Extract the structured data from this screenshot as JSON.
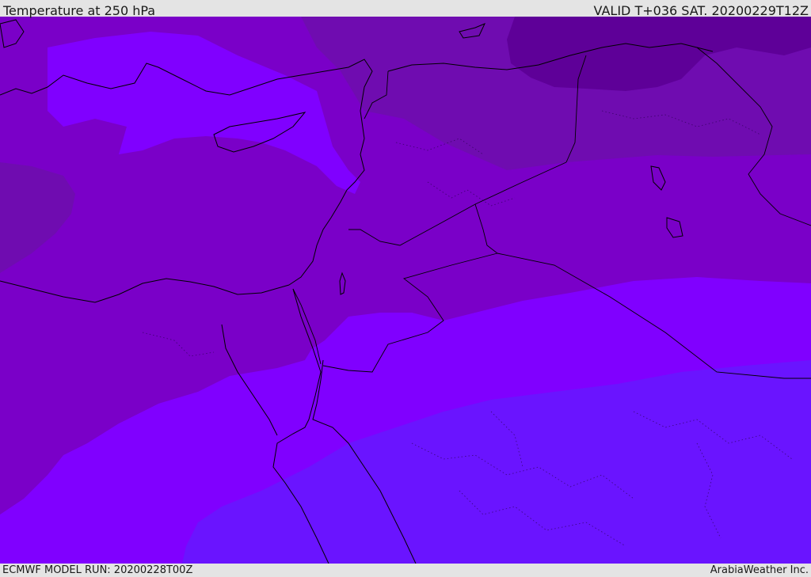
{
  "header": {
    "title": "Temperature at 250 hPa",
    "valid": "VALID T+036 SAT. 20200229T12Z"
  },
  "footer": {
    "model_run": "ECMWF MODEL RUN: 20200228T00Z",
    "credit": "ArabiaWeather Inc."
  },
  "map": {
    "variable": "Temperature",
    "level": "250 hPa",
    "region": "Eastern Mediterranean and Middle East",
    "colors": {
      "coldest_band": "#5e0098",
      "cold_band": "#6f0cb0",
      "cool_band": "#7a00c8",
      "mid_band": "#8000e6",
      "warm_band": "#8000ff",
      "warmest_band": "#6a14ff",
      "coastline": "#000000",
      "border": "#000000"
    }
  }
}
